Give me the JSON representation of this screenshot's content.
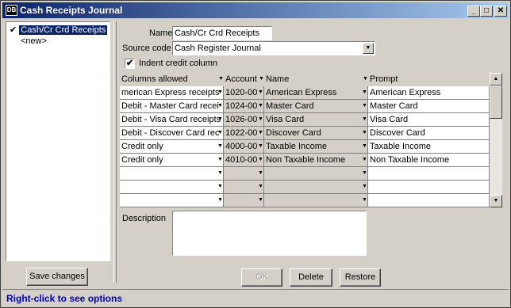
{
  "window": {
    "title": "Cash Receipts Journal",
    "icon_label": "DB",
    "controls": {
      "minimize": "_",
      "maximize": "□",
      "close": "✕"
    }
  },
  "tree": {
    "items": [
      {
        "label": "Cash/Cr Crd Receipts",
        "checked": true,
        "selected": true
      },
      {
        "label": "<new>",
        "checked": false,
        "selected": false
      }
    ],
    "check_glyph": "✔"
  },
  "save_changes": "Save changes",
  "form": {
    "name_label": "Name",
    "name_value": "Cash/Cr Crd Receipts",
    "source_code_label": "Source code",
    "source_code_value": "Cash Register Journal",
    "indent_label": "Indent credit column",
    "indent_checked": "✔",
    "description_label": "Description",
    "description_value": ""
  },
  "grid": {
    "headers": [
      "Columns allowed",
      "Account",
      "Name",
      "Prompt"
    ],
    "rows": [
      [
        "merican Express receipts",
        "1020-00",
        "American Express",
        "American Express"
      ],
      [
        "Debit - Master Card recei",
        "1024-00",
        "Master Card",
        "Master Card"
      ],
      [
        "Debit - Visa Card receipts",
        "1026-00",
        "Visa Card",
        "Visa Card"
      ],
      [
        "Debit - Discover Card rec",
        "1022-00",
        "Discover Card",
        "Discover Card"
      ],
      [
        "Credit only",
        "4000-00",
        "Taxable Income",
        "Taxable Income"
      ],
      [
        "Credit only",
        "4010-00",
        "Non Taxable Income",
        "Non Taxable Income"
      ],
      [
        "",
        "",
        "",
        ""
      ],
      [
        "",
        "",
        "",
        ""
      ],
      [
        "",
        "",
        "",
        ""
      ]
    ]
  },
  "buttons": {
    "ok": "OK",
    "delete": "Delete",
    "restore": "Restore"
  },
  "status": "Right-click to see options",
  "glyphs": {
    "down_arrow": "▼",
    "up_arrow": "▲"
  }
}
